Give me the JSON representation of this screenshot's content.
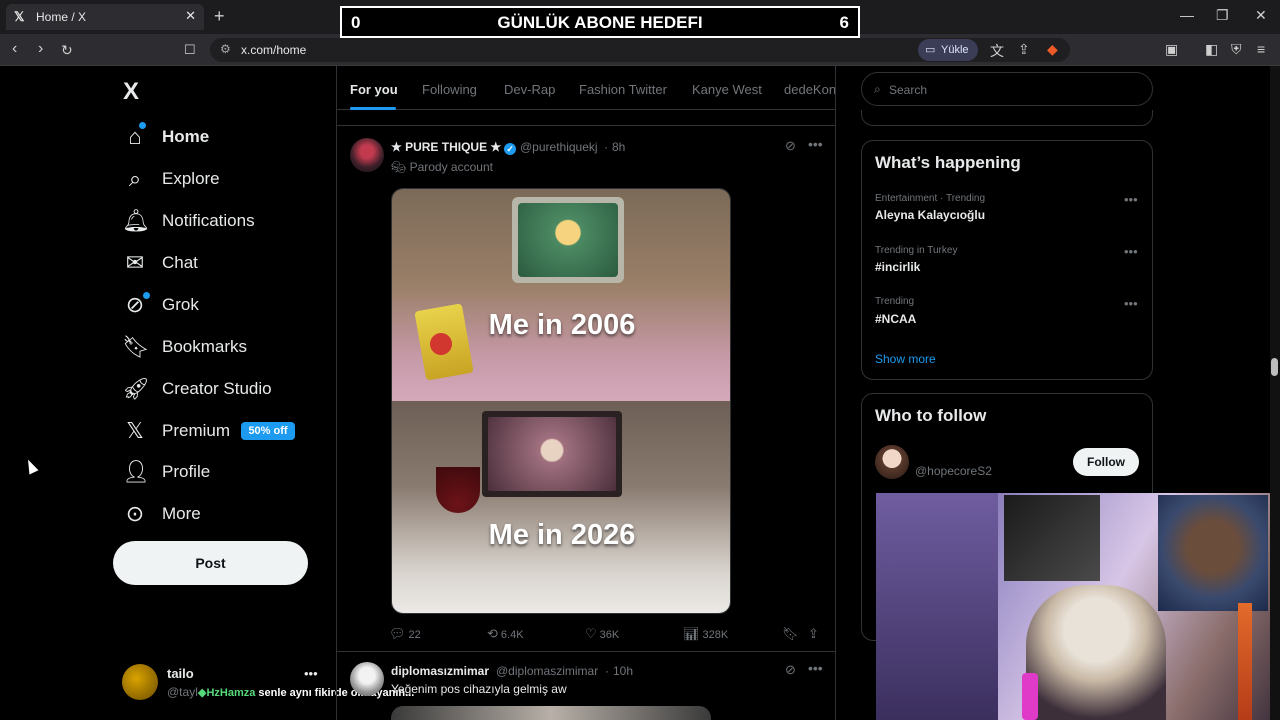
{
  "browser": {
    "tab_title": "Home / X",
    "tab_favicon": "x-logo-icon",
    "url": "x.com/home",
    "upload_label": "Yükle"
  },
  "overlay_goal": {
    "left": "0",
    "title": "GÜNLÜK ABONE HEDEFI",
    "right": "6"
  },
  "sidebar": {
    "logo": "X",
    "items": [
      {
        "label": "Home",
        "icon": "home-icon"
      },
      {
        "label": "Explore",
        "icon": "search-icon"
      },
      {
        "label": "Notifications",
        "icon": "bell-icon"
      },
      {
        "label": "Chat",
        "icon": "mail-icon"
      },
      {
        "label": "Grok",
        "icon": "grok-icon"
      },
      {
        "label": "Bookmarks",
        "icon": "bookmark-icon"
      },
      {
        "label": "Creator Studio",
        "icon": "rocket-icon"
      },
      {
        "label": "Premium",
        "icon": "x-logo-icon"
      },
      {
        "label": "Profile",
        "icon": "person-icon"
      },
      {
        "label": "More",
        "icon": "more-circle-icon"
      }
    ],
    "premium_badge": "50% off",
    "post_label": "Post",
    "account": {
      "name": "tailo",
      "handle": "@tayl"
    }
  },
  "chat_overlay": {
    "user": "HzHamza",
    "message": " senle aynı fikirde olmayanın..."
  },
  "timeline": {
    "tabs": [
      "For you",
      "Following",
      "Dev-Rap",
      "Fashion Twitter",
      "Kanye West",
      "dedeKon"
    ],
    "active_tab": 0,
    "tweets": [
      {
        "name": "★ PURE THIQUE ★",
        "verified": true,
        "handle": "@purethiquekj",
        "time": "8h",
        "label": "Parody account",
        "caption_top": "Me in 2006",
        "caption_bottom": "Me in 2026",
        "replies": "22",
        "reposts": "6.4K",
        "likes": "36K",
        "views": "328K"
      },
      {
        "name": "diplomasızmimar",
        "handle": "@diplomaszimimar",
        "time": "10h",
        "text": "Yeğenim pos cihazıyla gelmiş aw"
      }
    ]
  },
  "right": {
    "search_placeholder": "Search",
    "whats_happening_title": "What’s happening",
    "trends": [
      {
        "context": "Entertainment · Trending",
        "name": "Aleyna Kalaycıoğlu"
      },
      {
        "context": "Trending in Turkey",
        "name": "#incirlik"
      },
      {
        "context": "Trending",
        "name": "#NCAA"
      }
    ],
    "show_more": "Show more",
    "who_to_follow_title": "Who to follow",
    "follow_handle": "@hopecoreS2",
    "follow_label": "Follow"
  },
  "colors": {
    "accent": "#1d9bf0",
    "background": "#000000",
    "border": "#2f3336"
  }
}
